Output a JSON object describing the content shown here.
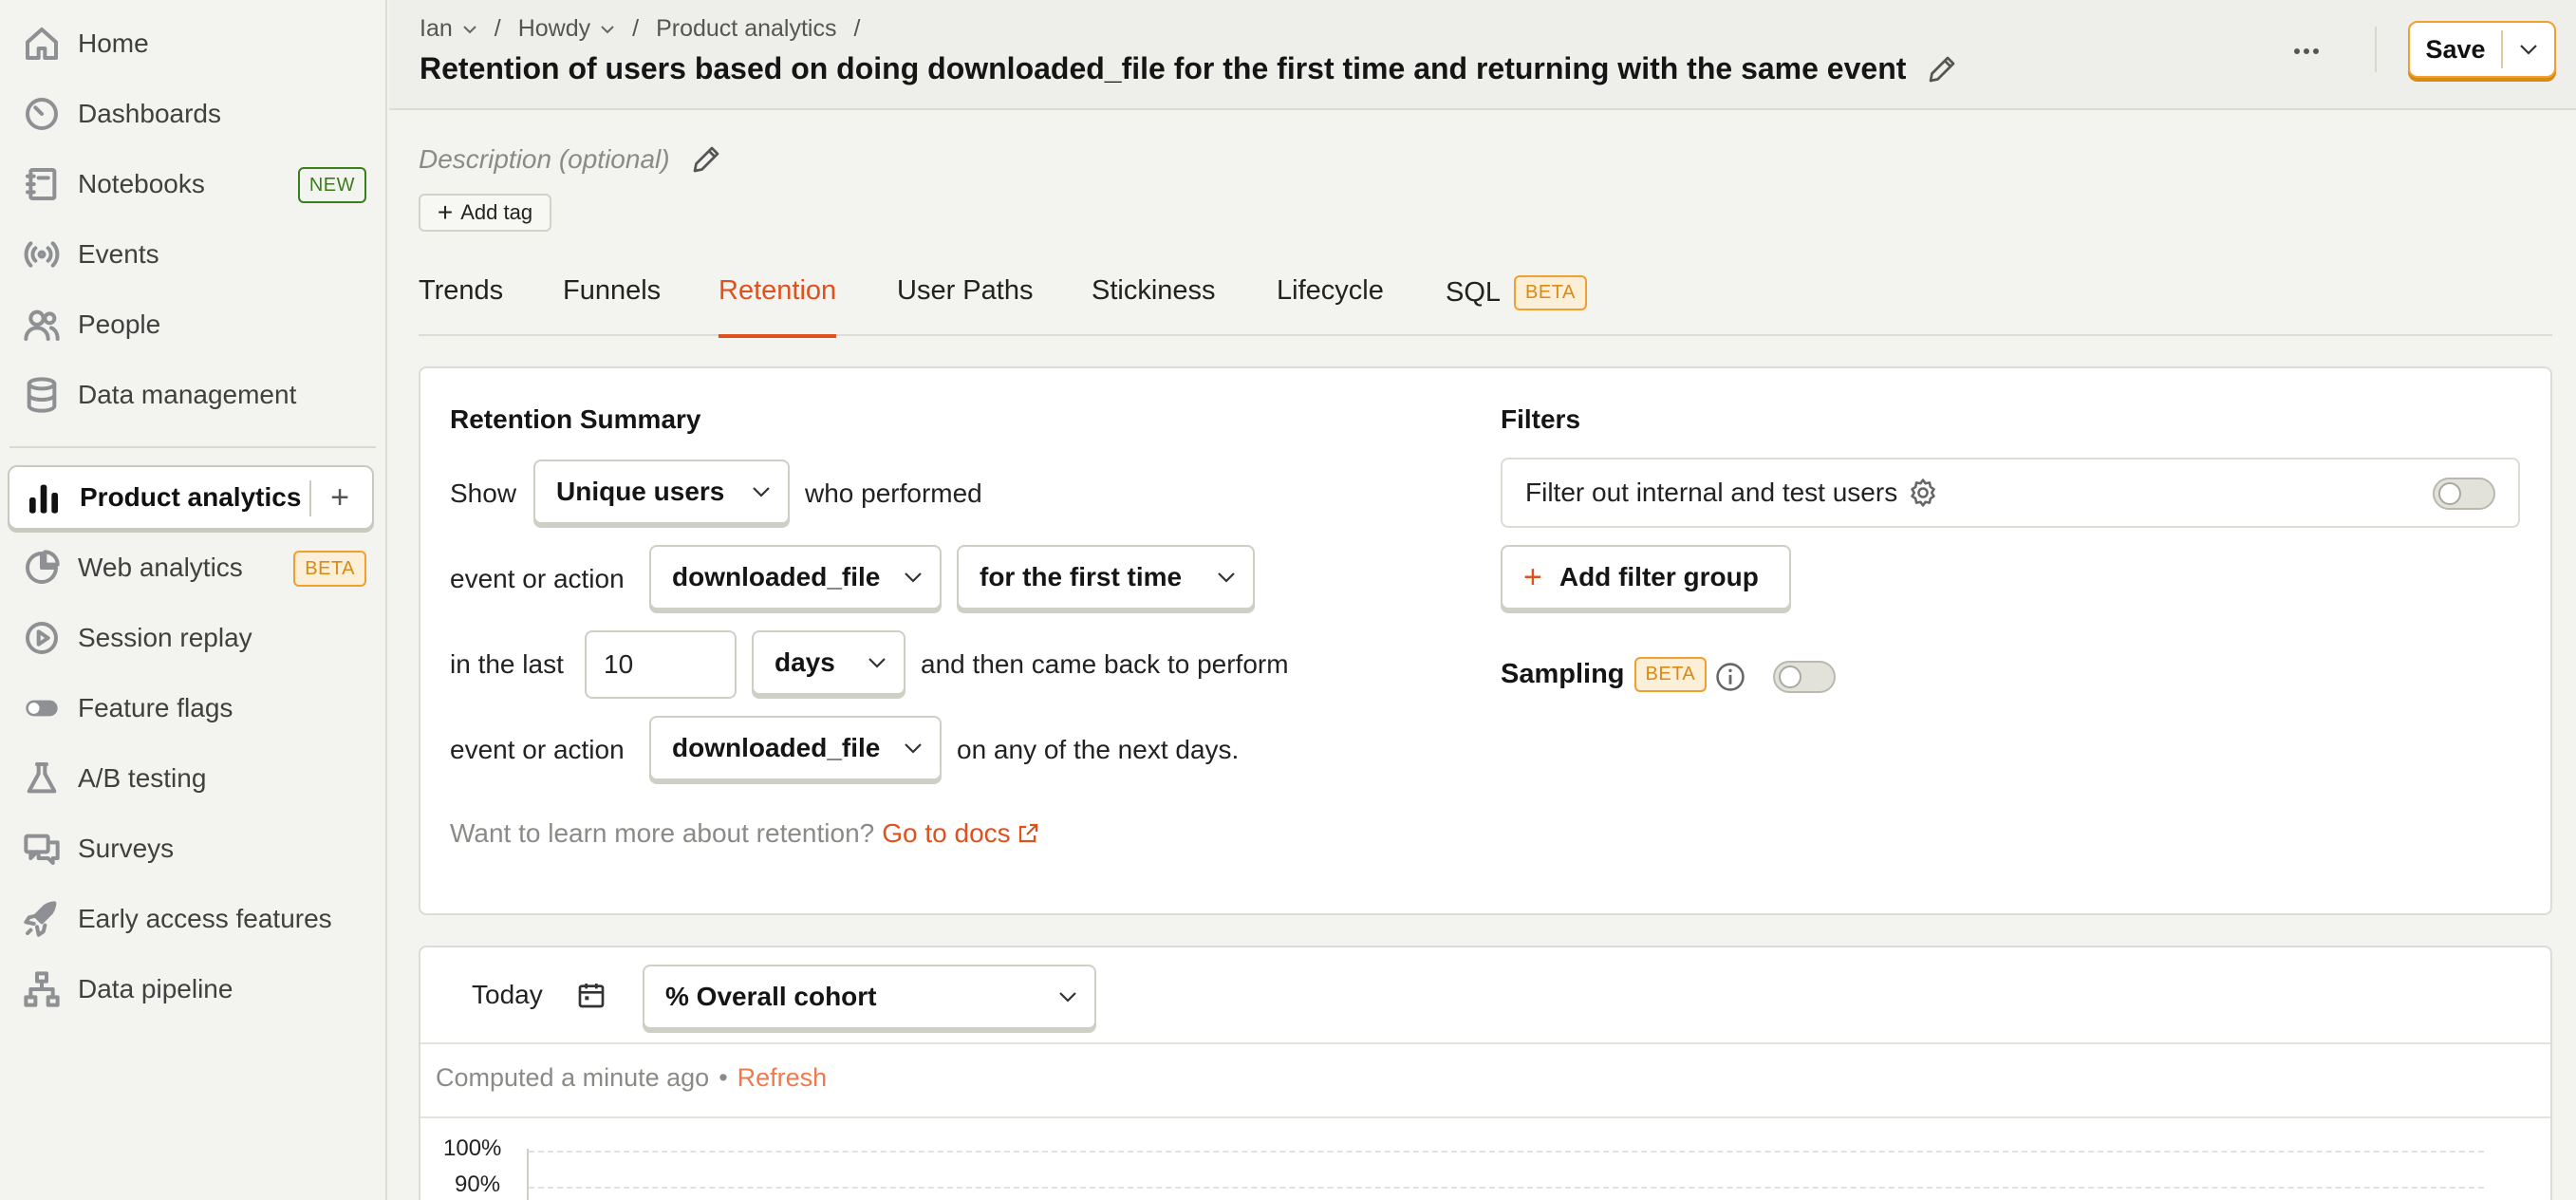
{
  "sidebar": {
    "items": [
      {
        "label": "Home",
        "icon": "home-icon"
      },
      {
        "label": "Dashboards",
        "icon": "dashboard-icon"
      },
      {
        "label": "Notebooks",
        "icon": "notebook-icon",
        "badge": "NEW"
      },
      {
        "label": "Events",
        "icon": "broadcast-icon"
      },
      {
        "label": "People",
        "icon": "people-icon"
      },
      {
        "label": "Data management",
        "icon": "database-icon"
      },
      {
        "label": "Product analytics",
        "icon": "bar-chart-icon",
        "active": true
      },
      {
        "label": "Web analytics",
        "icon": "pie-chart-icon",
        "badge": "BETA"
      },
      {
        "label": "Session replay",
        "icon": "play-circle-icon"
      },
      {
        "label": "Feature flags",
        "icon": "toggle-icon"
      },
      {
        "label": "A/B testing",
        "icon": "flask-icon"
      },
      {
        "label": "Surveys",
        "icon": "chat-bubbles-icon"
      },
      {
        "label": "Early access features",
        "icon": "rocket-icon"
      },
      {
        "label": "Data pipeline",
        "icon": "pipeline-icon"
      }
    ],
    "add_button": "+"
  },
  "header": {
    "breadcrumbs": [
      "Ian",
      "Howdy",
      "Product analytics"
    ],
    "breadcrumb_separator": "/",
    "title": "Retention of users based on doing downloaded_file for the first time and returning with the same event",
    "save_label": "Save"
  },
  "description_placeholder": "Description (optional)",
  "add_tag_label": "Add tag",
  "tabs": [
    {
      "label": "Trends"
    },
    {
      "label": "Funnels"
    },
    {
      "label": "Retention",
      "active": true
    },
    {
      "label": "User Paths"
    },
    {
      "label": "Stickiness"
    },
    {
      "label": "Lifecycle"
    },
    {
      "label": "SQL",
      "badge": "BETA"
    }
  ],
  "retention_summary": {
    "title": "Retention Summary",
    "show_label": "Show",
    "show_value": "Unique users",
    "who_performed": "who performed",
    "event_or_action_1": "event or action",
    "target_event": "downloaded_file",
    "period_type": "for the first time",
    "in_the_last": "in the last",
    "period_count": "10",
    "period_unit": "days",
    "came_back": "and then came back to perform",
    "event_or_action_2": "event or action",
    "returning_event": "downloaded_file",
    "next_days": "on any of the next days.",
    "learn_more": "Want to learn more about retention?",
    "docs_link": "Go to docs"
  },
  "filters": {
    "title": "Filters",
    "internal_filter_label": "Filter out internal and test users",
    "internal_filter_enabled": false,
    "add_filter_group": "Add filter group",
    "sampling_label": "Sampling",
    "sampling_badge": "BETA",
    "sampling_enabled": false
  },
  "results": {
    "date_label": "Today",
    "display_mode": "% Overall cohort",
    "computed_text": "Computed a minute ago",
    "separator": "•",
    "refresh_label": "Refresh",
    "y_ticks": [
      "100%",
      "90%"
    ]
  },
  "colors": {
    "accent": "#e0511e",
    "beta": "#f0a030",
    "new_badge": "#3a7d1c"
  }
}
